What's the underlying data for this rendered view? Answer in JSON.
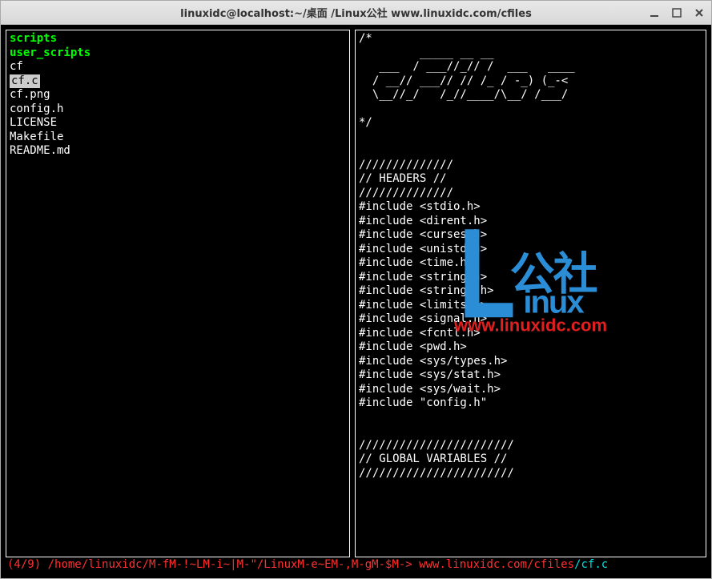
{
  "window": {
    "title": "linuxidc@localhost:~/桌面 /Linux公社  www.linuxidc.com/cfiles"
  },
  "left_pane": {
    "dirs": [
      "scripts",
      "user_scripts"
    ],
    "files": [
      "cf",
      "cf.c",
      "cf.png",
      "config.h",
      "LICENSE",
      "Makefile",
      "README.md"
    ],
    "selected": "cf.c"
  },
  "right_pane": {
    "lines": [
      "/*",
      "         _____ __ __",
      "   ___  / ___//_// /  ___   ____",
      "  / __// ___// // /_ / -_) (_-<",
      "  \\__//_/   /_//____/\\__/ /___/",
      "",
      "*/",
      "",
      "",
      "//////////////",
      "// HEADERS //",
      "//////////////",
      "#include <stdio.h>",
      "#include <dirent.h>",
      "#include <curses.h>",
      "#include <unistd.h>",
      "#include <time.h>",
      "#include <string.h>",
      "#include <strings.h>",
      "#include <limits.h>",
      "#include <signal.h>",
      "#include <fcntl.h>",
      "#include <pwd.h>",
      "#include <sys/types.h>",
      "#include <sys/stat.h>",
      "#include <sys/wait.h>",
      "#include \"config.h\"",
      "",
      "",
      "///////////////////////",
      "// GLOBAL VARIABLES //",
      "///////////////////////"
    ]
  },
  "statusbar": {
    "counter": "(4/9)",
    "path": " /home/linuxidc/M-fM-!~LM-i~|M-\"/LinuxM-e~EM-,M-gM-$M-> www.linuxidc.com/cfiles",
    "current": "/cf.c"
  },
  "watermark": {
    "cn": "公社",
    "en": "inux",
    "url": "www.linuxidc.com"
  }
}
